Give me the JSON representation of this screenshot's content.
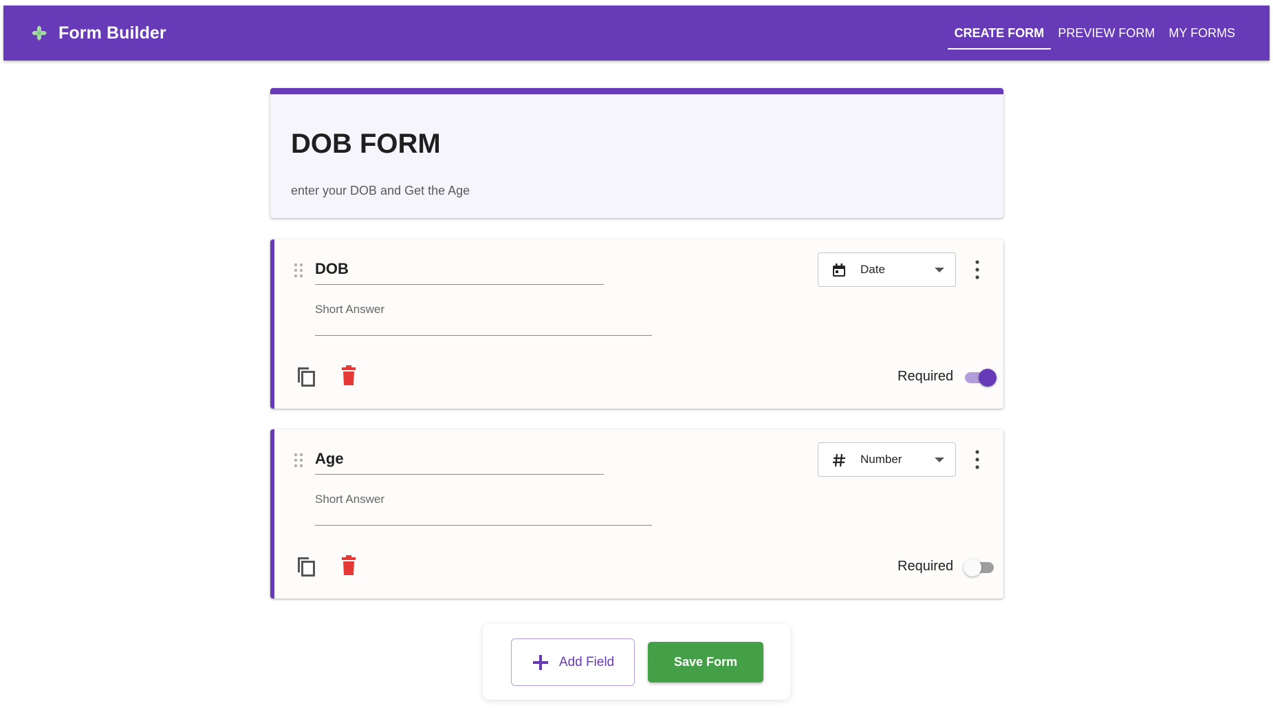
{
  "app": {
    "title": "Form Builder",
    "brand_icon": "puzzle-piece-icon",
    "accent_color": "#673ab7"
  },
  "nav": {
    "tabs": [
      {
        "label": "CREATE FORM",
        "active": true
      },
      {
        "label": "PREVIEW FORM",
        "active": false
      },
      {
        "label": "MY FORMS",
        "active": false
      }
    ]
  },
  "form": {
    "title": "DOB FORM",
    "description": "enter your DOB and Get the Age"
  },
  "fields": [
    {
      "label": "DOB",
      "placeholder": "Short Answer",
      "type": "Date",
      "type_icon": "calendar-icon",
      "required_label": "Required",
      "required": true
    },
    {
      "label": "Age",
      "placeholder": "Short Answer",
      "type": "Number",
      "type_icon": "hash-icon",
      "required_label": "Required",
      "required": false
    }
  ],
  "actions": {
    "add_label": "Add Field",
    "save_label": "Save Form",
    "save_color": "#43a047",
    "delete_color": "#e53935"
  }
}
